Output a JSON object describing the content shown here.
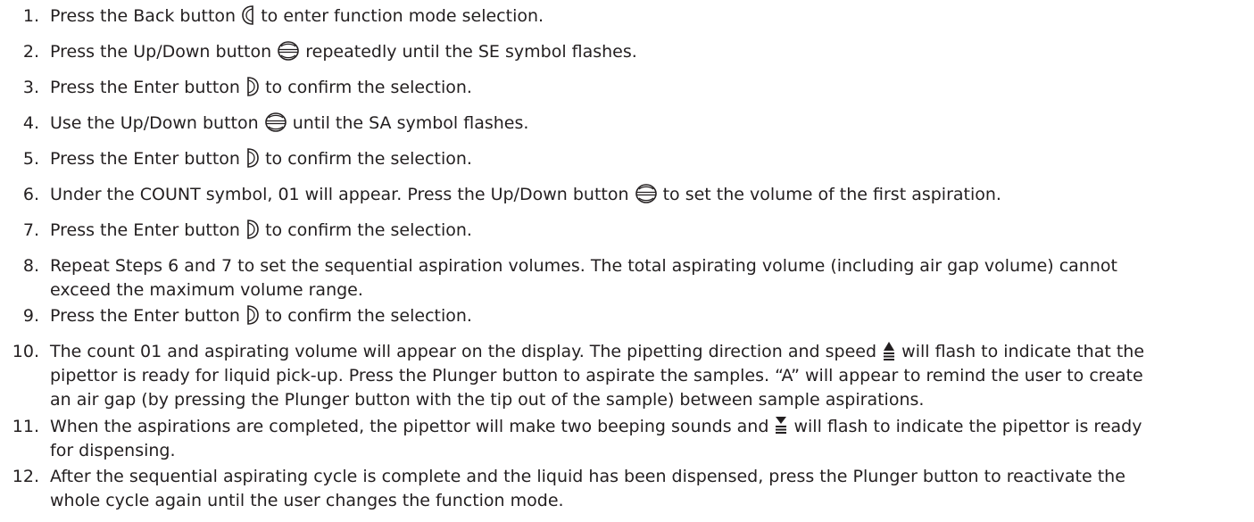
{
  "steps": [
    {
      "num": "1.",
      "a": "Press the Back button",
      "icon": "back-button-icon",
      "b": "to enter function mode selection."
    },
    {
      "num": "2.",
      "a": "Press the Up/Down button",
      "icon": "up-down-button-icon",
      "b": "repeatedly until the SE symbol flashes."
    },
    {
      "num": "3.",
      "a": "Press the Enter button",
      "icon": "enter-button-icon",
      "b": "to confirm the selection."
    },
    {
      "num": "4.",
      "a": "Use the Up/Down button",
      "icon": "up-down-button-icon",
      "b": "until the SA symbol flashes."
    },
    {
      "num": "5.",
      "a": "Press the Enter button",
      "icon": "enter-button-icon",
      "b": "to confirm the selection."
    },
    {
      "num": "6.",
      "a": "Under the COUNT symbol, 01 will appear. Press the Up/Down button",
      "icon": "up-down-button-icon",
      "b": "to set the volume of the first aspiration."
    },
    {
      "num": "7.",
      "a": "Press the Enter button",
      "icon": "enter-button-icon",
      "b": "to confirm the selection."
    },
    {
      "num": "8.",
      "line1": "Repeat Steps 6 and 7 to set the sequential aspiration volumes. The total aspirating volume (including air gap volume) cannot",
      "line2": "exceed the maximum volume range."
    },
    {
      "num": "9.",
      "a": "Press the Enter button",
      "icon": "enter-button-icon",
      "b": "to confirm the selection."
    },
    {
      "num": "10.",
      "a": "The count 01 and aspirating volume will appear on the display. The pipetting direction and speed",
      "icon": "aspirate-direction-icon",
      "b": "will flash to indicate that the",
      "line2": "pipettor is ready for liquid pick-up. Press the Plunger button to aspirate the samples. “A” will appear to remind the user to create",
      "line3": "an air gap (by pressing the Plunger button with the tip out of the sample) between sample aspirations."
    },
    {
      "num": "11.",
      "a": "When the aspirations are completed, the pipettor will make two beeping sounds and",
      "icon": "dispense-direction-icon",
      "b": "will flash to indicate the pipettor is ready",
      "line2": "for dispensing."
    },
    {
      "num": "12.",
      "line1": "After the sequential aspirating cycle is complete and the liquid has been dispensed, press the Plunger button to reactivate the",
      "line2": "whole cycle again until the user changes the function mode."
    }
  ]
}
